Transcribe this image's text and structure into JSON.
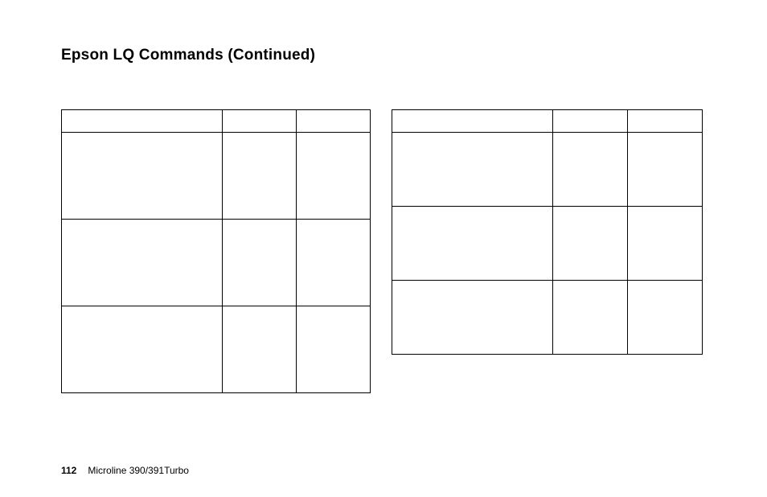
{
  "title": "Epson LQ Commands (Continued)",
  "left_table": {
    "headers": [
      "",
      "",
      ""
    ],
    "rows": [
      [
        "",
        "",
        ""
      ],
      [
        "",
        "",
        ""
      ],
      [
        "",
        "",
        ""
      ]
    ]
  },
  "right_table": {
    "headers": [
      "",
      "",
      ""
    ],
    "rows": [
      [
        "",
        "",
        ""
      ],
      [
        "",
        "",
        ""
      ],
      [
        "",
        "",
        ""
      ]
    ]
  },
  "footer": {
    "page_number": "112",
    "model": "Microline 390/391Turbo"
  }
}
